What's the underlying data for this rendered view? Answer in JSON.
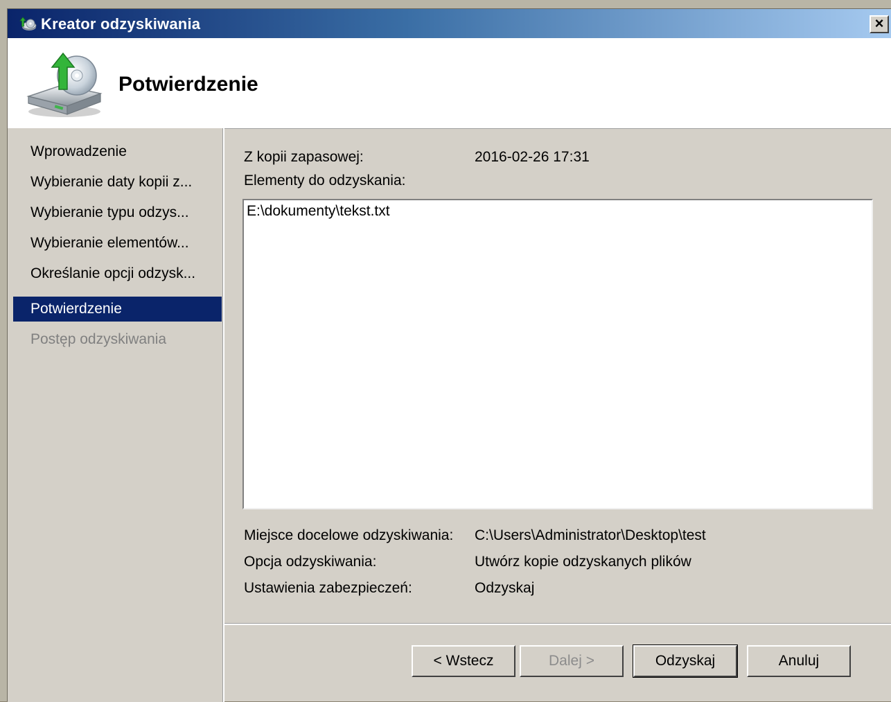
{
  "window": {
    "title": "Kreator odzyskiwania",
    "close_label": "×"
  },
  "header": {
    "title": "Potwierdzenie"
  },
  "sidebar": {
    "steps": [
      {
        "label": "Wprowadzenie",
        "state": "normal"
      },
      {
        "label": "Wybieranie daty kopii z...",
        "state": "normal"
      },
      {
        "label": "Wybieranie typu odzys...",
        "state": "normal"
      },
      {
        "label": "Wybieranie elementów...",
        "state": "normal"
      },
      {
        "label": "Określanie opcji odzysk...",
        "state": "normal"
      },
      {
        "label": "Potwierdzenie",
        "state": "active"
      },
      {
        "label": "Postęp odzyskiwania",
        "state": "disabled"
      }
    ]
  },
  "summary": {
    "backup_label": "Z kopii zapasowej:",
    "backup_value": "2016-02-26 17:31",
    "items_label": "Elementy do odzyskania:",
    "items": [
      "E:\\dokumenty\\tekst.txt"
    ],
    "destination_label": "Miejsce docelowe odzyskiwania:",
    "destination_value": "C:\\Users\\Administrator\\Desktop\\test",
    "option_label": "Opcja odzyskiwania:",
    "option_value": "Utwórz kopie odzyskanych plików",
    "security_label": "Ustawienia zabezpieczeń:",
    "security_value": "Odzyskaj"
  },
  "buttons": {
    "back": "< Wstecz",
    "next": "Dalej >",
    "recover": "Odzyskaj",
    "cancel": "Anuluj"
  },
  "colors": {
    "titlebar_start": "#0a246a",
    "titlebar_end": "#a6caf0",
    "selection": "#0a246a",
    "face": "#d4d0c8"
  }
}
